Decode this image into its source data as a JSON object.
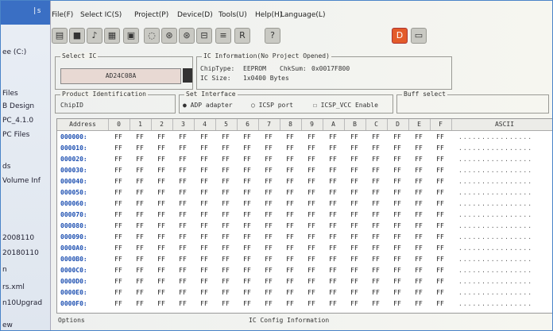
{
  "left_panel": {
    "title": "|s",
    "items": [
      "ee (C:)",
      "Files",
      "B Design",
      "PC_4.1.0",
      "PC Files",
      "ds",
      "Volume Inf",
      "2008110",
      "20180110",
      "n",
      "rs.xml",
      "n10Upgrad",
      "ew"
    ]
  },
  "menu": [
    "File(F)",
    "Select IC(S)",
    "Project(P)",
    "Device(D)",
    "Tools(U)",
    "Help(H)",
    "Language(L)"
  ],
  "toolbar_icons": [
    "open-icon",
    "save-icon",
    "chip-select-icon",
    "chip-info-icon",
    "grid-icon",
    "erase-icon",
    "read-icon",
    "write-icon",
    "verify-icon",
    "blank-check-icon",
    "auto-icon",
    "help-icon",
    "device-red-icon",
    "device-icon"
  ],
  "select_ic": {
    "label": "Select IC",
    "value": "AD24C08A"
  },
  "ic_info": {
    "label": "IC Information(No Project Opened)",
    "chip_type_label": "ChipType:",
    "chip_type_value": "EEPROM",
    "checksum_label": "ChkSum:",
    "checksum_value": "0x0017F800",
    "size_label": "IC Size:",
    "size_value": "1x0400 Bytes"
  },
  "product_id": {
    "label": "Product Identification",
    "value": "ChipID"
  },
  "set_interface": {
    "label": "Set Interface",
    "opt1": "ADP adapter",
    "opt2": "ICSP port",
    "check": "ICSP_VCC Enable"
  },
  "buff_select": {
    "label": "Buff select"
  },
  "hex_grid": {
    "columns": [
      "Address",
      "0",
      "1",
      "2",
      "3",
      "4",
      "5",
      "6",
      "7",
      "8",
      "9",
      "A",
      "B",
      "C",
      "D",
      "E",
      "F",
      "ASCII"
    ],
    "addresses": [
      "000000:",
      "000010:",
      "000020:",
      "000030:",
      "000040:",
      "000050:",
      "000060:",
      "000070:",
      "000080:",
      "000090:",
      "0000A0:",
      "0000B0:",
      "0000C0:",
      "0000D0:",
      "0000E0:",
      "0000F0:"
    ],
    "byte_value": "FF",
    "ascii_value": "................"
  },
  "bottom": {
    "options_label": "Options",
    "config_label": "IC Config Information"
  }
}
